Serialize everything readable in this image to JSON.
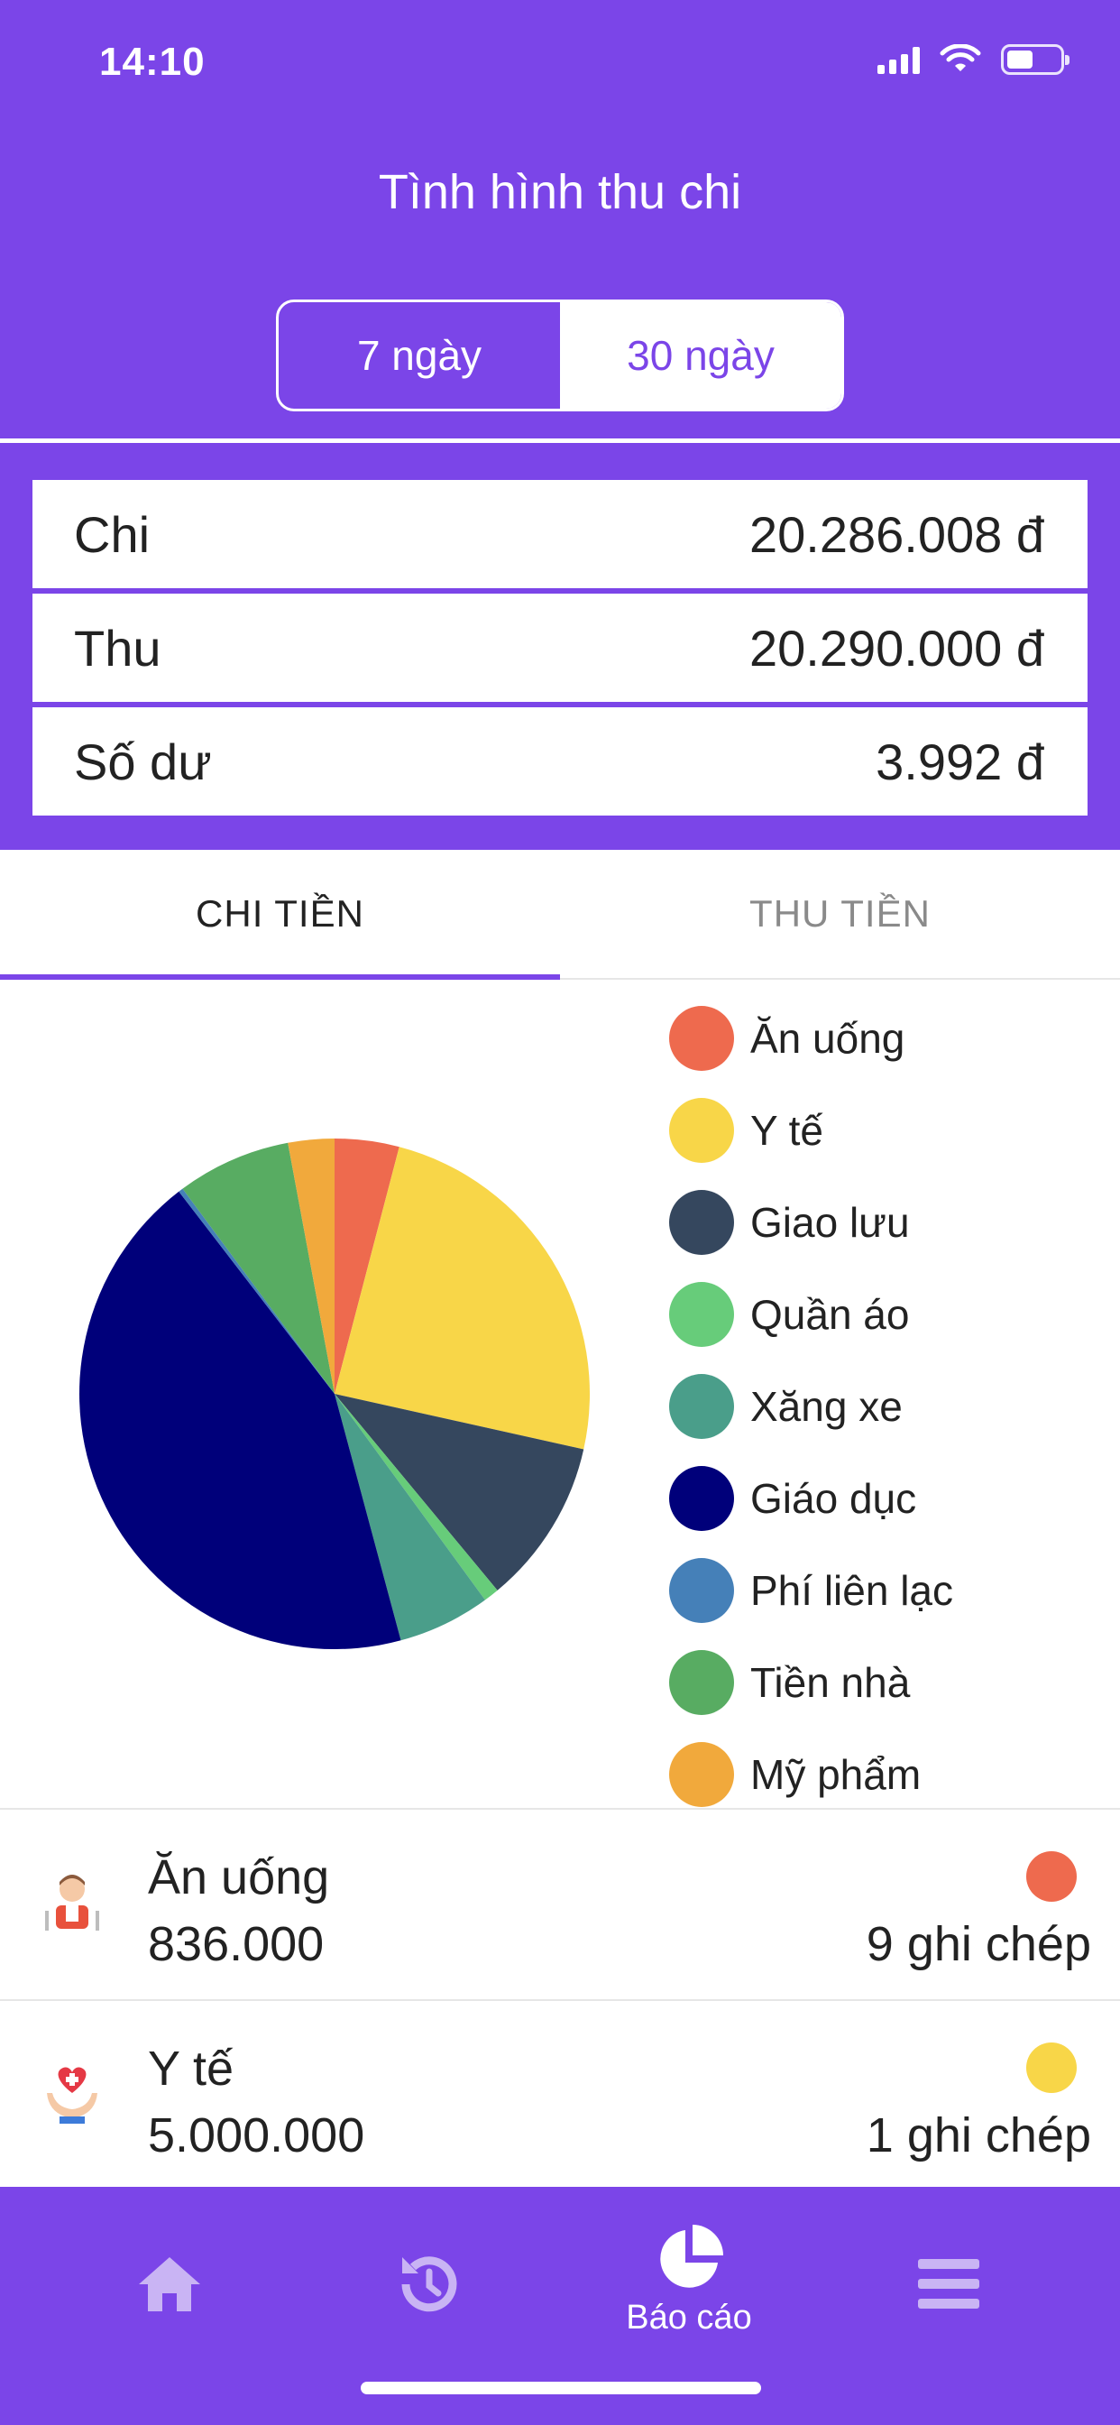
{
  "status_bar": {
    "time": "14:10"
  },
  "header": {
    "title": "Tình hình thu chi"
  },
  "period_toggle": {
    "options": [
      "7 ngày",
      "30 ngày"
    ],
    "selected": "30 ngày"
  },
  "summary": [
    {
      "label": "Chi",
      "value": "20.286.008 đ"
    },
    {
      "label": "Thu",
      "value": "20.290.000 đ"
    },
    {
      "label": "Số dư",
      "value": "3.992 đ"
    }
  ],
  "tabs": [
    {
      "label": "CHI TIỀN",
      "active": true
    },
    {
      "label": "THU TIỀN",
      "active": false
    }
  ],
  "chart_data": {
    "type": "pie",
    "categories": [
      "Ăn uống",
      "Y tế",
      "Giao lưu",
      "Quần áo",
      "Xăng xe",
      "Giáo dục",
      "Phí liên lạc",
      "Tiền nhà",
      "Mỹ phẩm"
    ],
    "values": [
      836000,
      5000000,
      2150000,
      200000,
      1200000,
      8960000,
      60000,
      1480000,
      600000
    ],
    "colors": [
      "#EE6A4E",
      "#F8D648",
      "#35475E",
      "#67CC7A",
      "#4A9E8A",
      "#00007A",
      "#4580B8",
      "#58AC62",
      "#F1A93C"
    ],
    "legend": "right"
  },
  "category_list": [
    {
      "name": "Ăn uống",
      "amount": "836.000",
      "count": "9 ghi chép",
      "color": "#EE6A4E",
      "icon": "dining-person-icon"
    },
    {
      "name": "Y tế",
      "amount": "5.000.000",
      "count": "1 ghi chép",
      "color": "#F8D648",
      "icon": "health-care-icon"
    }
  ],
  "nav": [
    {
      "icon": "home-icon",
      "label": ""
    },
    {
      "icon": "history-icon",
      "label": ""
    },
    {
      "icon": "pie-chart-icon",
      "label": "Báo cáo",
      "active": true
    },
    {
      "icon": "menu-icon",
      "label": ""
    }
  ]
}
